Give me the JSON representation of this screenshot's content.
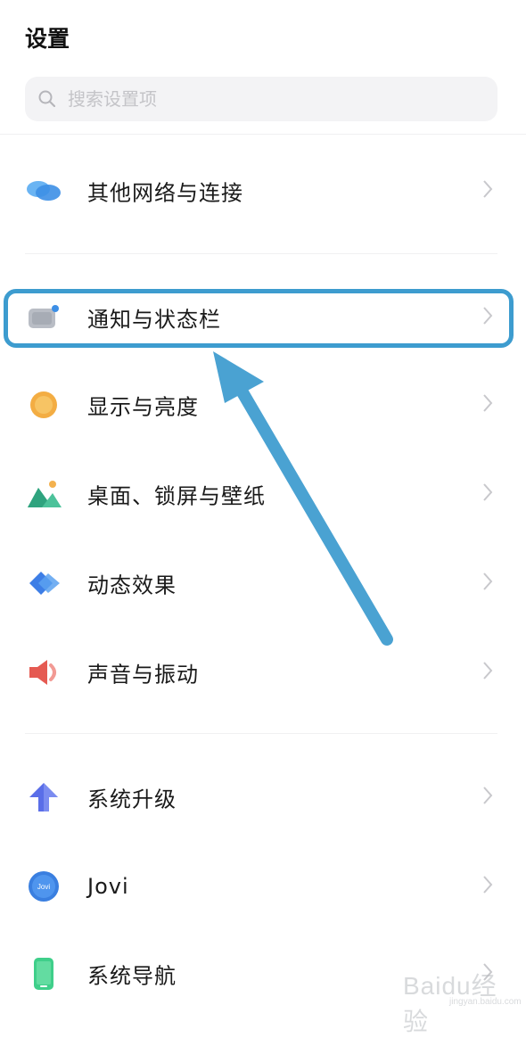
{
  "header": {
    "title": "设置"
  },
  "search": {
    "placeholder": "搜索设置项"
  },
  "items": [
    {
      "label": "其他网络与连接",
      "icon": "network-connection-icon"
    },
    {
      "label": "通知与状态栏",
      "icon": "notification-statusbar-icon",
      "highlighted": true
    },
    {
      "label": "显示与亮度",
      "icon": "display-brightness-icon"
    },
    {
      "label": "桌面、锁屏与壁纸",
      "icon": "wallpaper-icon"
    },
    {
      "label": "动态效果",
      "icon": "dynamic-effects-icon"
    },
    {
      "label": "声音与振动",
      "icon": "sound-vibration-icon"
    },
    {
      "label": "系统升级",
      "icon": "system-upgrade-icon"
    },
    {
      "label": "Jovi",
      "icon": "jovi-icon",
      "icon_text": "Jovi"
    },
    {
      "label": "系统导航",
      "icon": "system-navigation-icon"
    }
  ],
  "watermark": {
    "brand": "Baidu经验",
    "sub": "jingyan.baidu.com"
  },
  "colors": {
    "highlight": "#3d9ccf",
    "arrow": "#4aa2d2"
  }
}
